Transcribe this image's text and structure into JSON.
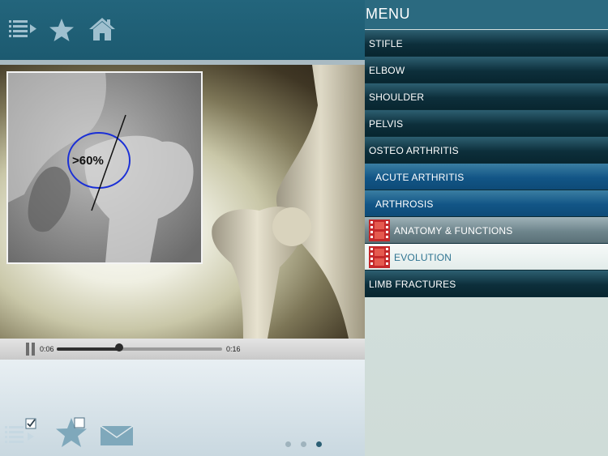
{
  "header": {
    "icons": [
      "list-menu-icon",
      "star-icon",
      "home-icon"
    ]
  },
  "video": {
    "xray_label": ">60%",
    "current_time": "0:06",
    "total_time": "0:16",
    "progress": 0.375
  },
  "menu": {
    "title": "MENU",
    "items": [
      {
        "label": "STIFLE",
        "style": "dark"
      },
      {
        "label": "ELBOW",
        "style": "dark"
      },
      {
        "label": "SHOULDER",
        "style": "dark"
      },
      {
        "label": "PELVIS",
        "style": "dark"
      },
      {
        "label": "OSTEO ARTHRITIS",
        "style": "dark"
      },
      {
        "label": "ACUTE ARTHRITIS",
        "style": "sub-blue"
      },
      {
        "label": "ARTHROSIS",
        "style": "sub-blue"
      },
      {
        "label": "ANATOMY & FUNCTIONS",
        "style": "video-gray",
        "icon": "film-icon"
      },
      {
        "label": "EVOLUTION",
        "style": "video-selected",
        "icon": "film-icon"
      },
      {
        "label": "LIMB FRACTURES",
        "style": "dark"
      }
    ]
  },
  "footer": {
    "icons": [
      "checklist-icon",
      "favorite-star-icon",
      "mail-icon"
    ],
    "page_count": 3,
    "current_page": 3
  },
  "colors": {
    "header": "#23657c",
    "menu_dark": "#0d2f3b",
    "menu_sub": "#125586",
    "film_red": "#c4282a"
  }
}
